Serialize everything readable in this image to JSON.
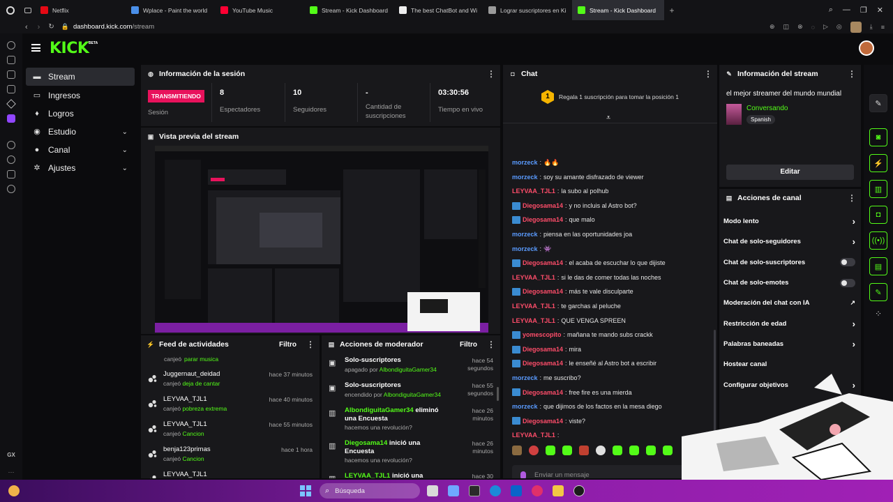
{
  "browser": {
    "tabs": [
      {
        "label": "Netflix",
        "color": "#e50914"
      },
      {
        "label": "Wplace - Paint the world",
        "color": "#4a8fe8"
      },
      {
        "label": "YouTube Music",
        "color": "#ff0033"
      },
      {
        "label": "Stream - Kick Dashboard",
        "color": "#53fc18"
      },
      {
        "label": "The best ChatBot and Wi",
        "color": "#eeeeee"
      },
      {
        "label": "Lograr suscriptores en Ki",
        "color": "#9a9a9a"
      },
      {
        "label": "Stream - Kick Dashboard",
        "color": "#53fc18",
        "active": true
      }
    ],
    "url_host": "dashboard.kick.com",
    "url_path": "/stream",
    "gx_label": "GX"
  },
  "app": {
    "logo": "KICK",
    "logo_beta": "BETA"
  },
  "sidebar": {
    "items": [
      {
        "label": "Stream",
        "icon": "video-icon",
        "glyph": "▬",
        "active": true
      },
      {
        "label": "Ingresos",
        "icon": "money-icon",
        "glyph": "▭"
      },
      {
        "label": "Logros",
        "icon": "trophy-icon",
        "glyph": "♦"
      },
      {
        "label": "Estudio",
        "icon": "palette-icon",
        "glyph": "◉",
        "chevron": true
      },
      {
        "label": "Canal",
        "icon": "user-icon",
        "glyph": "●",
        "chevron": true
      },
      {
        "label": "Ajustes",
        "icon": "gear-icon",
        "glyph": "✲",
        "chevron": true
      }
    ]
  },
  "session": {
    "title": "Información de la sesión",
    "live_badge": "TRANSMITIENDO",
    "session_label": "Sesión",
    "stats": [
      {
        "value": "8",
        "label": "Espectadores"
      },
      {
        "value": "10",
        "label": "Seguidores"
      },
      {
        "value": "-",
        "label": "Cantidad de suscripciones"
      },
      {
        "value": "03:30:56",
        "label": "Tiempo en vivo"
      }
    ]
  },
  "preview": {
    "title": "Vista previa del stream"
  },
  "feed": {
    "title": "Feed de actividades",
    "filter": "Filtro",
    "top_partial": {
      "action": "canjeó",
      "item": "parar musica"
    },
    "items": [
      {
        "user": "Juggernaut_deidad",
        "action": "canjeó",
        "item": "deja de cantar",
        "time": "hace 37 minutos"
      },
      {
        "user": "LEYVAA_TJL1",
        "action": "canjeó",
        "item": "pobreza extrema",
        "time": "hace 40 minutos"
      },
      {
        "user": "LEYVAA_TJL1",
        "action": "canjeó",
        "item": "Cancion",
        "time": "hace 55 minutos"
      },
      {
        "user": "benja123primas",
        "action": "canjeó",
        "item": "Cancion",
        "time": "hace 1 hora"
      },
      {
        "user": "LEYVAA_TJL1",
        "action": "",
        "item": "",
        "time": ""
      }
    ]
  },
  "modactions": {
    "title": "Acciones de moderador",
    "filter": "Filtro",
    "items": [
      {
        "title": "Solo-suscriptores",
        "sub_prefix": "apagado por",
        "by": "AlbondiguitaGamer34",
        "time": "hace 54 segundos"
      },
      {
        "title": "Solo-suscriptores",
        "sub_prefix": "encendido por",
        "by": "AlbondiguitaGamer34",
        "time": "hace 55 segundos"
      },
      {
        "title_user": "AlbondiguitaGamer34",
        "title_rest": "eliminó una Encuesta",
        "sub": "hacemos una revolución?",
        "time": "hace 26 minutos"
      },
      {
        "title_user": "Diegosama14",
        "title_rest": "inició una Encuesta",
        "sub": "hacemos una revolución?",
        "time": "hace 26 minutos"
      },
      {
        "title_user": "LEYVAA_TJL1",
        "title_rest": "inició una",
        "sub": "",
        "time": "hace 30"
      }
    ]
  },
  "chat": {
    "title": "Chat",
    "gift_text": "Regala 1 suscripción para tomar la posición 1",
    "gift_position": "1",
    "input_placeholder": "Enviar un mensaje",
    "messages": [
      {
        "user": "morzeck",
        "color": "#5a9bff",
        "badge": false,
        "text": "🔥🔥"
      },
      {
        "user": "morzeck",
        "color": "#5a9bff",
        "badge": false,
        "text": "soy su amante disfrazado de viewer"
      },
      {
        "user": "LEYVAA_TJL1",
        "color": "#ff4d6a",
        "badge": false,
        "text": "la subo al polhub"
      },
      {
        "user": "Diegosama14",
        "color": "#ff4d6a",
        "badge": true,
        "text": "y no incluis al Astro bot?"
      },
      {
        "user": "Diegosama14",
        "color": "#ff4d6a",
        "badge": true,
        "text": "que malo"
      },
      {
        "user": "morzeck",
        "color": "#5a9bff",
        "badge": false,
        "text": "piensa en las oportunidades joa"
      },
      {
        "user": "morzeck",
        "color": "#5a9bff",
        "badge": false,
        "text": "👾"
      },
      {
        "user": "Diegosama14",
        "color": "#ff4d6a",
        "badge": true,
        "text": "el acaba de escuchar lo que dijiste"
      },
      {
        "user": "LEYVAA_TJL1",
        "color": "#ff4d6a",
        "badge": false,
        "text": "si le das de comer todas las noches"
      },
      {
        "user": "Diegosama14",
        "color": "#ff4d6a",
        "badge": true,
        "text": "más te vale disculparte"
      },
      {
        "user": "LEYVAA_TJL1",
        "color": "#ff4d6a",
        "badge": false,
        "text": "te garchas al peluche"
      },
      {
        "user": "LEYVAA_TJL1",
        "color": "#ff4d6a",
        "badge": false,
        "text": "QUE VENGA SPREEN"
      },
      {
        "user": "yomescopito",
        "color": "#ff4d6a",
        "badge": true,
        "text": "mañana te mando subs crackk"
      },
      {
        "user": "Diegosama14",
        "color": "#ff4d6a",
        "badge": true,
        "text": "mira"
      },
      {
        "user": "Diegosama14",
        "color": "#ff4d6a",
        "badge": true,
        "text": "le enseñé al Astro bot a escribir"
      },
      {
        "user": "morzeck",
        "color": "#5a9bff",
        "badge": false,
        "text": "me suscribo?"
      },
      {
        "user": "Diegosama14",
        "color": "#ff4d6a",
        "badge": true,
        "text": "free fire es una mierda"
      },
      {
        "user": "morzeck",
        "color": "#5a9bff",
        "badge": false,
        "text": "que dijimos de los factos en la mesa diego"
      },
      {
        "user": "Diegosama14",
        "color": "#ff4d6a",
        "badge": true,
        "text": "viste?"
      },
      {
        "user": "LEYVAA_TJL1",
        "color": "#ff4d6a",
        "badge": false,
        "text": ""
      }
    ]
  },
  "streaminfo": {
    "title": "Información del stream",
    "stream_title": "el mejor streamer del mundo mundial",
    "category": "Conversando",
    "language": "Spanish",
    "edit_button": "Editar"
  },
  "channelactions": {
    "title": "Acciones de canal",
    "items": [
      {
        "label": "Modo lento",
        "control": "chevron"
      },
      {
        "label": "Chat de solo-seguidores",
        "control": "chevron"
      },
      {
        "label": "Chat de solo-suscriptores",
        "control": "toggle"
      },
      {
        "label": "Chat de solo-emotes",
        "control": "toggle"
      },
      {
        "label": "Moderación del chat con IA",
        "control": "external"
      },
      {
        "label": "Restricción de edad",
        "control": "chevron"
      },
      {
        "label": "Palabras baneadas",
        "control": "chevron"
      },
      {
        "label": "Hostear canal",
        "control": "none"
      },
      {
        "label": "Configurar objetivos",
        "control": "chevron"
      }
    ]
  },
  "taskbar": {
    "search_placeholder": "Búsqueda"
  },
  "colors": {
    "kick_green": "#53fc18",
    "live_red": "#e8125c",
    "panel_bg": "#18181b"
  }
}
